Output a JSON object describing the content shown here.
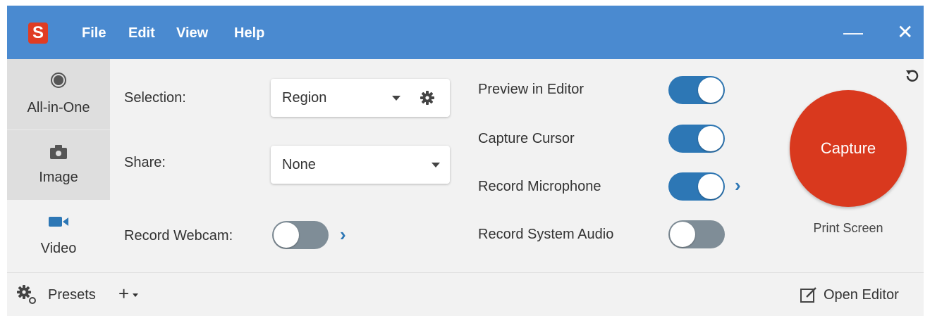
{
  "app": {
    "logo_letter": "S"
  },
  "menu": {
    "file": "File",
    "edit": "Edit",
    "view": "View",
    "help": "Help"
  },
  "window_controls": {
    "minimize": "—",
    "close": "✕"
  },
  "sidebar": {
    "items": [
      {
        "label": "All-in-One",
        "icon": "all-in-one-icon"
      },
      {
        "label": "Image",
        "icon": "camera-icon"
      },
      {
        "label": "Video",
        "icon": "video-camera-icon"
      }
    ]
  },
  "settings": {
    "selection_label": "Selection:",
    "selection_value": "Region",
    "share_label": "Share:",
    "share_value": "None",
    "webcam_label": "Record Webcam:",
    "webcam_on": false
  },
  "options": [
    {
      "label": "Preview in Editor",
      "on": true
    },
    {
      "label": "Capture Cursor",
      "on": true
    },
    {
      "label": "Record Microphone",
      "on": true
    },
    {
      "label": "Record System Audio",
      "on": false
    }
  ],
  "capture": {
    "button_label": "Capture",
    "shortcut": "Print Screen"
  },
  "footer": {
    "presets_label": "Presets",
    "add_label": "+",
    "open_editor_label": "Open Editor"
  },
  "colors": {
    "titlebar": "#4a8ad0",
    "capture": "#d9391e",
    "toggle_on": "#2d77b5",
    "toggle_off": "#7f8d97"
  }
}
